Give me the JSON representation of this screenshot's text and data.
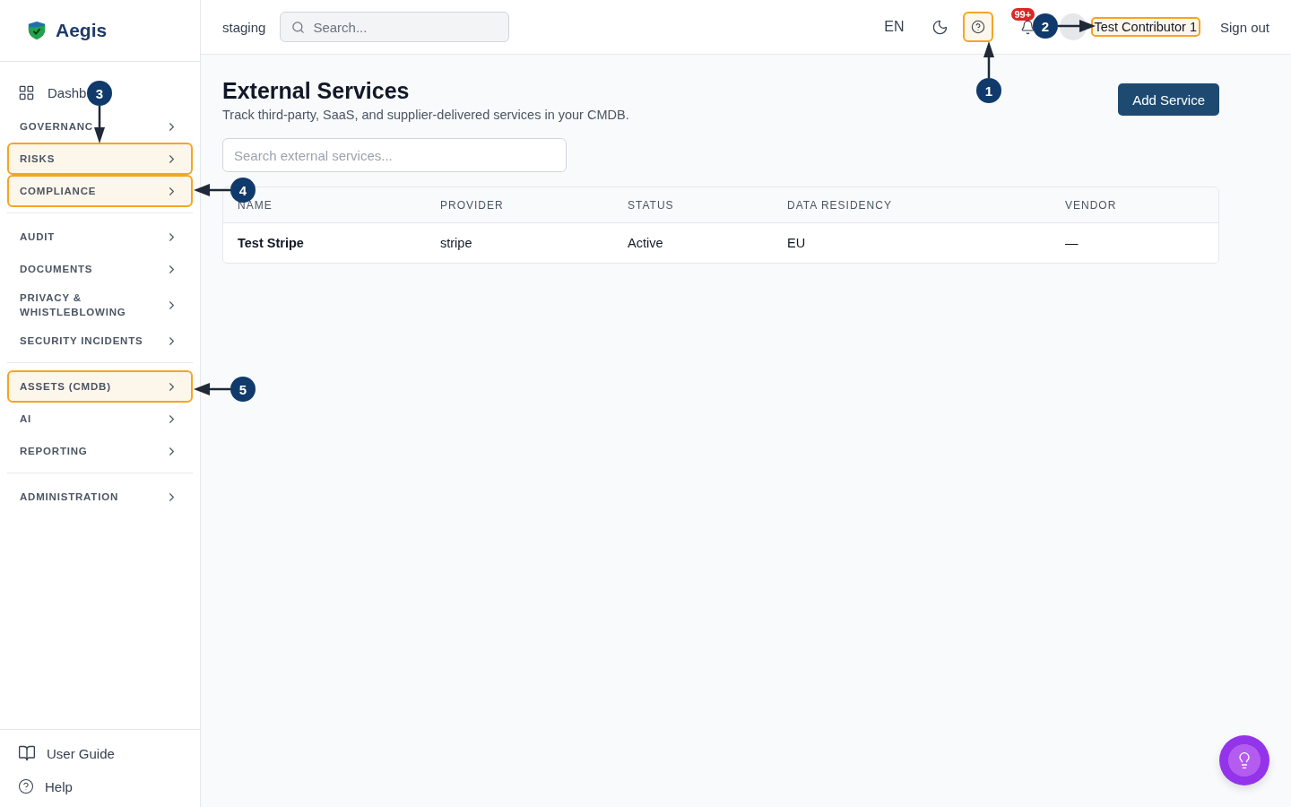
{
  "brand": "Aegis",
  "topbar": {
    "environment": "staging",
    "search": {
      "placeholder": "Search..."
    },
    "language": "EN",
    "help": {
      "highlighted": true
    },
    "notifications": "99+",
    "user": {
      "name": "Test Contributor 1",
      "highlighted": true
    },
    "sign_out": "Sign out"
  },
  "sidebar": {
    "dashboard": "Dashb",
    "sections": [
      [
        {
          "label": "GOVERNANC",
          "highlighted": false
        },
        {
          "label": "RISKS",
          "highlighted": true
        },
        {
          "label": "COMPLIANCE",
          "highlighted": true
        }
      ],
      [
        {
          "label": "AUDIT",
          "highlighted": false
        },
        {
          "label": "DOCUMENTS",
          "highlighted": false
        },
        {
          "label": "PRIVACY & WHISTLEBLOWING",
          "highlighted": false
        },
        {
          "label": "SECURITY INCIDENTS",
          "highlighted": false
        }
      ],
      [
        {
          "label": "ASSETS (CMDB)",
          "highlighted": true
        },
        {
          "label": "AI",
          "highlighted": false
        },
        {
          "label": "REPORTING",
          "highlighted": false
        }
      ],
      [
        {
          "label": "ADMINISTRATION",
          "highlighted": false
        }
      ]
    ],
    "footer": [
      {
        "label": "User Guide",
        "kind": "guide"
      },
      {
        "label": "Help",
        "kind": "help"
      }
    ]
  },
  "page": {
    "title": "External Services",
    "subtitle": "Track third-party, SaaS, and supplier-delivered services in your CMDB.",
    "add_button": "Add Service",
    "search": {
      "placeholder": "Search external services..."
    },
    "table": {
      "columns": [
        "NAME",
        "PROVIDER",
        "STATUS",
        "DATA RESIDENCY",
        "VENDOR"
      ],
      "rows": [
        [
          "Test Stripe",
          "stripe",
          "Active",
          "EU",
          "—"
        ]
      ]
    }
  },
  "annotations": [
    {
      "number": "1"
    },
    {
      "number": "2"
    },
    {
      "number": "3"
    },
    {
      "number": "4"
    },
    {
      "number": "5"
    }
  ]
}
